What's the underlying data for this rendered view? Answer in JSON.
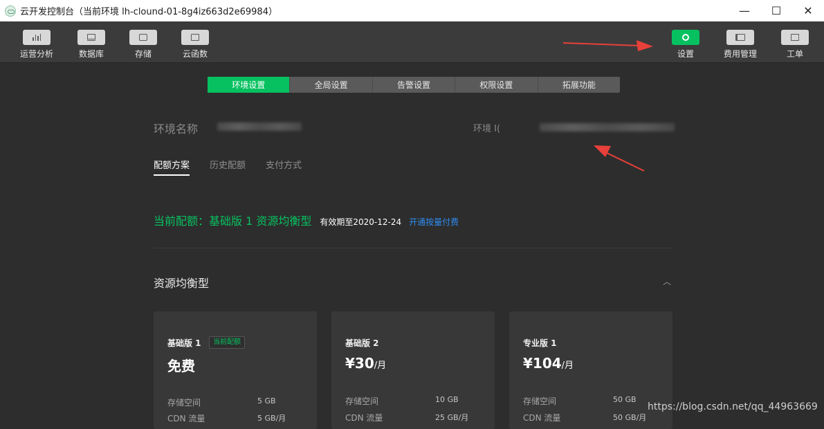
{
  "window": {
    "title": "云开发控制台（当前环境 lh-clound-01-8g4iz663d2e69984）",
    "controls": [
      "—",
      "☐",
      "✕"
    ]
  },
  "toolbar": {
    "left": [
      {
        "label": "运营分析",
        "icon": "bar-chart-icon"
      },
      {
        "label": "数据库",
        "icon": "database-icon"
      },
      {
        "label": "存储",
        "icon": "storage-icon"
      },
      {
        "label": "云函数",
        "icon": "function-icon"
      }
    ],
    "right": [
      {
        "label": "设置",
        "icon": "gear-icon"
      },
      {
        "label": "费用管理",
        "icon": "billing-icon"
      },
      {
        "label": "工单",
        "icon": "ticket-icon"
      }
    ]
  },
  "settings_tabs": [
    "环境设置",
    "全局设置",
    "告警设置",
    "权限设置",
    "拓展功能"
  ],
  "env": {
    "name_label": "环境名称",
    "id_label": "环境 I("
  },
  "subtabs": [
    "配额方案",
    "历史配额",
    "支付方式"
  ],
  "quota": {
    "current": "当前配额：基础版 1 资源均衡型",
    "expire": "有效期至2020-12-24",
    "link": "开通按量付费"
  },
  "section": {
    "title": "资源均衡型",
    "collapse_icon": "chevron-up-icon"
  },
  "plans": [
    {
      "name": "基础版 1",
      "badge": "当前配额",
      "price": "免费",
      "unit": "",
      "specs": [
        {
          "label": "存储空间",
          "value": "5 GB"
        },
        {
          "label": "CDN 流量",
          "value": "5 GB/月"
        }
      ]
    },
    {
      "name": "基础版 2",
      "badge": "",
      "price": "¥30",
      "unit": "/月",
      "specs": [
        {
          "label": "存储空间",
          "value": "10 GB"
        },
        {
          "label": "CDN 流量",
          "value": "25 GB/月"
        }
      ]
    },
    {
      "name": "专业版 1",
      "badge": "",
      "price": "¥104",
      "unit": "/月",
      "specs": [
        {
          "label": "存储空间",
          "value": "50 GB"
        },
        {
          "label": "CDN 流量",
          "value": "50 GB/月"
        }
      ]
    }
  ],
  "colors": {
    "accent": "#07c160",
    "link": "#2e8df1",
    "annotation_arrow": "#e8403a"
  },
  "watermark": "https://blog.csdn.net/qq_44963669"
}
